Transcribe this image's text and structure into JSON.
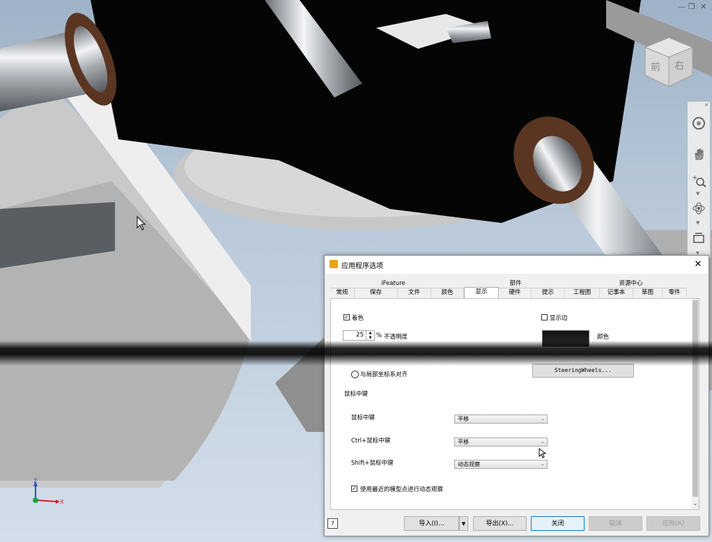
{
  "window_controls": {
    "minimize": "—",
    "restore": "❐",
    "close": "✕"
  },
  "viewcube": {
    "face_front": "前",
    "face_right": "右"
  },
  "triad": {
    "z": "Z",
    "x": "X"
  },
  "dialog": {
    "title": "应用程序选项",
    "close_icon": "✕",
    "tab_groups": [
      {
        "label": "iFeature"
      },
      {
        "label": "部件"
      },
      {
        "label": "资源中心"
      }
    ],
    "tabs": [
      {
        "label": "常规"
      },
      {
        "label": "保存"
      },
      {
        "label": "文件"
      },
      {
        "label": "颜色"
      },
      {
        "label": "显示",
        "active": true
      },
      {
        "label": "硬件"
      },
      {
        "label": "提示"
      },
      {
        "label": "工程图"
      },
      {
        "label": "记事本"
      },
      {
        "label": "草图"
      },
      {
        "label": "零件"
      }
    ],
    "panel": {
      "shading_checkbox_label": "着色",
      "shading_checked": true,
      "show_edges_label": "显示边",
      "show_edges_checked": false,
      "opacity_value": "25",
      "opacity_unit": "%",
      "opacity_label": "不透明度",
      "color_label": "颜色",
      "steering_button": "SteeringWheels...",
      "align_radio_label": "与局部坐标系对齐",
      "mouse_section_title": "鼠标中键",
      "rows": [
        {
          "label": "鼠标中键",
          "value": "平移"
        },
        {
          "label": "Ctrl+鼠标中键",
          "value": "平移"
        },
        {
          "label": "Shift+鼠标中键",
          "value": "动态观察"
        }
      ],
      "nearest_point_label": "使用最近的模型点进行动态观察",
      "nearest_point_checked": true
    },
    "footer": {
      "help": "?",
      "import": "导入(I)...",
      "export": "导出(X)...",
      "close": "关闭",
      "cancel": "取消",
      "apply": "应用(A)"
    }
  },
  "colors": {
    "dialog_bg": "#f0f0f0",
    "primary_border": "#0078d7",
    "swatch": "#111111"
  }
}
